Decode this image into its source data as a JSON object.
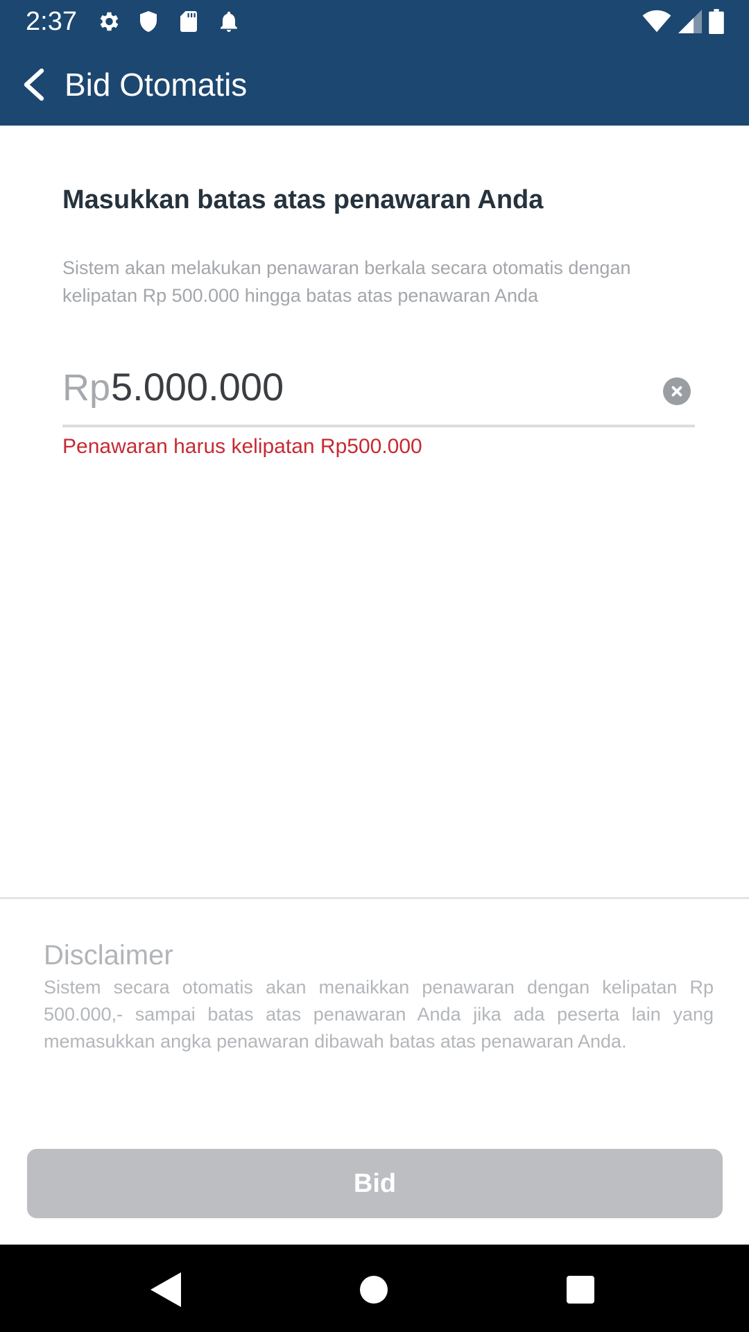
{
  "status_bar": {
    "time": "2:37",
    "left_icons": [
      "settings-icon",
      "shield-icon",
      "sd-card-icon",
      "notification-bell-icon"
    ],
    "right_icons": [
      "wifi-icon",
      "cell-signal-icon",
      "battery-icon"
    ]
  },
  "app_bar": {
    "title": "Bid Otomatis",
    "back_icon": "chevron-left-icon"
  },
  "form": {
    "heading": "Masukkan batas atas penawaran Anda",
    "description": "Sistem akan melakukan penawaran berkala secara otomatis dengan kelipatan Rp 500.000 hingga batas atas penawaran Anda",
    "currency_prefix": "Rp",
    "amount_value": "5.000.000",
    "error": "Penawaran harus kelipatan Rp500.000"
  },
  "disclaimer": {
    "title": "Disclaimer",
    "text": "Sistem secara otomatis akan menaikkan penawaran dengan kelipatan Rp 500.000,- sampai batas atas penawaran Anda jika ada peserta lain yang memasukkan angka penawaran dibawah batas atas penawaran Anda."
  },
  "actions": {
    "bid_label": "Bid",
    "bid_enabled": false
  },
  "colors": {
    "header_bg": "#1c4770",
    "error": "#c62a33",
    "button_disabled": "#bcbec1"
  }
}
